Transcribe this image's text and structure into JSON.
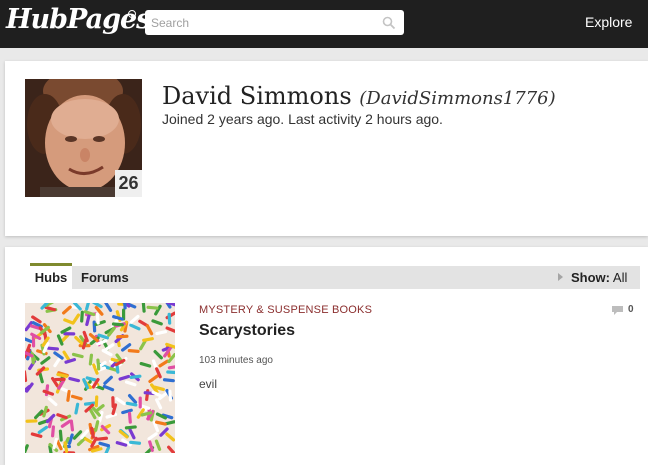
{
  "header": {
    "logo": "HubPages",
    "search": {
      "placeholder": "Search",
      "value": ""
    },
    "explore_label": "Explore"
  },
  "profile": {
    "name": "David Simmons",
    "handle": "(DavidSimmons1776)",
    "meta": "Joined 2 years ago. Last activity 2 hours ago.",
    "score": "26"
  },
  "hubs_panel": {
    "tabs": [
      {
        "label": "Hubs",
        "active": true
      },
      {
        "label": "Forums",
        "active": false
      }
    ],
    "show_label": "Show:",
    "show_value": "All",
    "items": [
      {
        "category": "MYSTERY & SUSPENSE BOOKS",
        "title": "Scarystories",
        "time": "103 minutes ago",
        "summary": "evil",
        "comments": "0"
      }
    ]
  },
  "colors": {
    "topbar": "#1f1f1f",
    "tab_accent": "#7f8a2e",
    "category": "#8b2e2e"
  },
  "icons": [
    "search-icon",
    "comment-icon",
    "show-arrow-icon"
  ]
}
